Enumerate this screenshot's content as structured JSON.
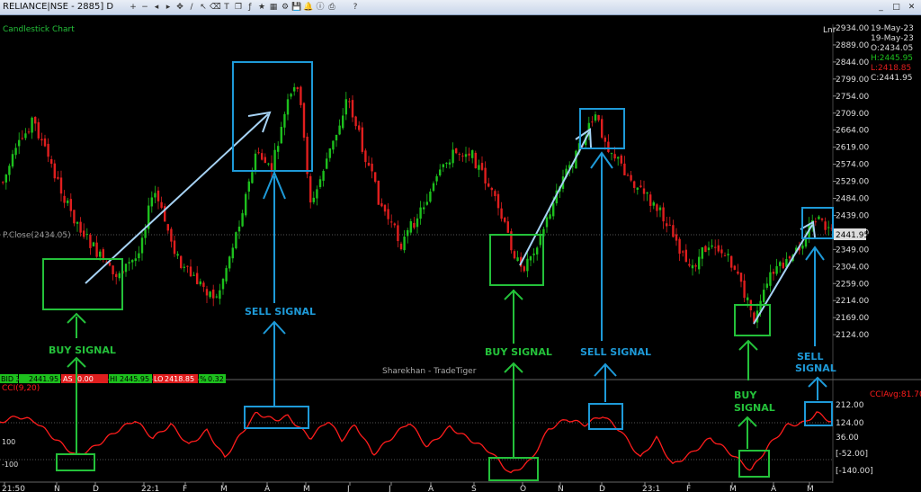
{
  "window": {
    "title": "RELIANCE|NSE - 2885] D",
    "toolbar_icons": [
      "zoom-in-icon",
      "zoom-out-icon",
      "scroll-left-icon",
      "scroll-right-icon",
      "pan-icon",
      "line-icon",
      "select-icon",
      "eraser-icon",
      "text-icon",
      "copy-icon",
      "indicator-icon",
      "star-icon",
      "grid-icon",
      "settings-icon",
      "save-icon",
      "bell-icon",
      "info-icon",
      "print-icon",
      "sep",
      "help-icon"
    ],
    "toolbar_glyphs": [
      "+",
      "−",
      "◂",
      "▸",
      "✥",
      "/",
      "↖",
      "⌫",
      "T",
      "❐",
      "ƒ",
      "★",
      "▦",
      "⚙",
      "💾",
      "🔔",
      "ⓘ",
      "⎙",
      "",
      "?"
    ],
    "controls": [
      "_",
      "□",
      "✕"
    ]
  },
  "chart": {
    "panel_label": "Candlestick Chart",
    "scale_label": "Lnr",
    "date_block": [
      "19-May-23",
      "19-May-23"
    ],
    "ohlc": {
      "open": "O:2434.05",
      "high": "H:2445.95",
      "low": "L:2418.85",
      "close": "C:2441.95"
    },
    "price_axis": [
      "2934.00",
      "2889.00",
      "2844.00",
      "2799.00",
      "2754.00",
      "2709.00",
      "2664.00",
      "2619.00",
      "2574.00",
      "2529.00",
      "2484.00",
      "2439.00",
      "2394.00",
      "2349.00",
      "2304.00",
      "2259.00",
      "2214.00",
      "2169.00",
      "2124.00"
    ],
    "last_price_tag": "2441.95",
    "prev_close_label": "P.Close(2434.05)",
    "watermark": "Sharekhan - TradeTiger"
  },
  "quote_bar": {
    "bid": "BID 348",
    "bid_price": "2441.95",
    "ask": "AS",
    "ask_price": "0.00",
    "hi": "HI",
    "hi_price": "2445.95",
    "lo": "LO",
    "lo_price": "2418.85",
    "pct": "%",
    "pct_value": "0.32"
  },
  "cci": {
    "label": "CCI(9,20)",
    "avg_label": "CCIAvg:81.70",
    "axis_right": [
      "212.00",
      "124.00",
      "36.00",
      "[-52.00]",
      "[-140.00]"
    ],
    "axis_left": [
      "100",
      "-100"
    ]
  },
  "x_axis": [
    "21:50",
    "N",
    "D",
    "22:1",
    "F",
    "M",
    "A",
    "M",
    "J",
    "J",
    "A",
    "S",
    "O",
    "N",
    "D",
    "23:1",
    "F",
    "M",
    "A",
    "M"
  ],
  "annotations": {
    "buy_signal": "BUY SIGNAL",
    "sell_signal": "SELL SIGNAL",
    "buy_split": [
      "BUY",
      "SIGNAL"
    ],
    "sell_split": [
      "SELL",
      "SIGNAL"
    ],
    "colors": {
      "buy": "#24c13a",
      "sell": "#1e9ad8",
      "up": "#1dc01d",
      "down": "#e01e1e",
      "cci": "#ff1c1c"
    }
  }
}
